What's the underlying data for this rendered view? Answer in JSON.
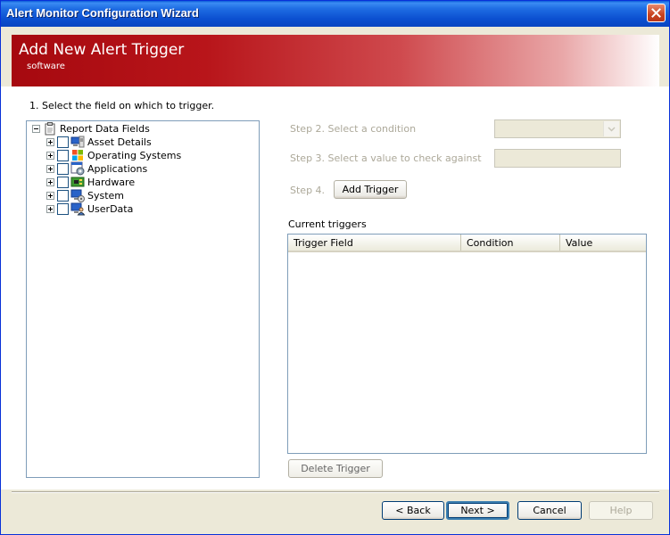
{
  "window": {
    "title": "Alert Monitor Configuration Wizard"
  },
  "banner": {
    "title": "Add New Alert Trigger",
    "subtitle": "software"
  },
  "step1": {
    "label": "1. Select the field on which to trigger."
  },
  "tree": {
    "root": {
      "label": "Report Data Fields",
      "icon": "clipboard-icon"
    },
    "items": [
      {
        "label": "Asset Details",
        "icon": "asset-details-icon"
      },
      {
        "label": "Operating Systems",
        "icon": "windows-logo-icon"
      },
      {
        "label": "Applications",
        "icon": "applications-icon"
      },
      {
        "label": "Hardware",
        "icon": "hardware-icon"
      },
      {
        "label": "System",
        "icon": "system-icon"
      },
      {
        "label": "UserData",
        "icon": "userdata-icon"
      }
    ]
  },
  "step2": {
    "label": "Step 2. Select a condition",
    "value": ""
  },
  "step3": {
    "label": "Step 3. Select a value to check against",
    "value": ""
  },
  "step4": {
    "label": "Step 4.",
    "add_button": "Add Trigger"
  },
  "triggers": {
    "label": "Current triggers",
    "columns": [
      "Trigger Field",
      "Condition",
      "Value"
    ],
    "rows": [],
    "delete_button": "Delete Trigger"
  },
  "footer": {
    "back": "< Back",
    "next": "Next >",
    "cancel": "Cancel",
    "help": "Help"
  },
  "colors": {
    "banner_red": "#a6090f",
    "titlebar_blue": "#0b4fd0",
    "disabled_text": "#aca899"
  }
}
